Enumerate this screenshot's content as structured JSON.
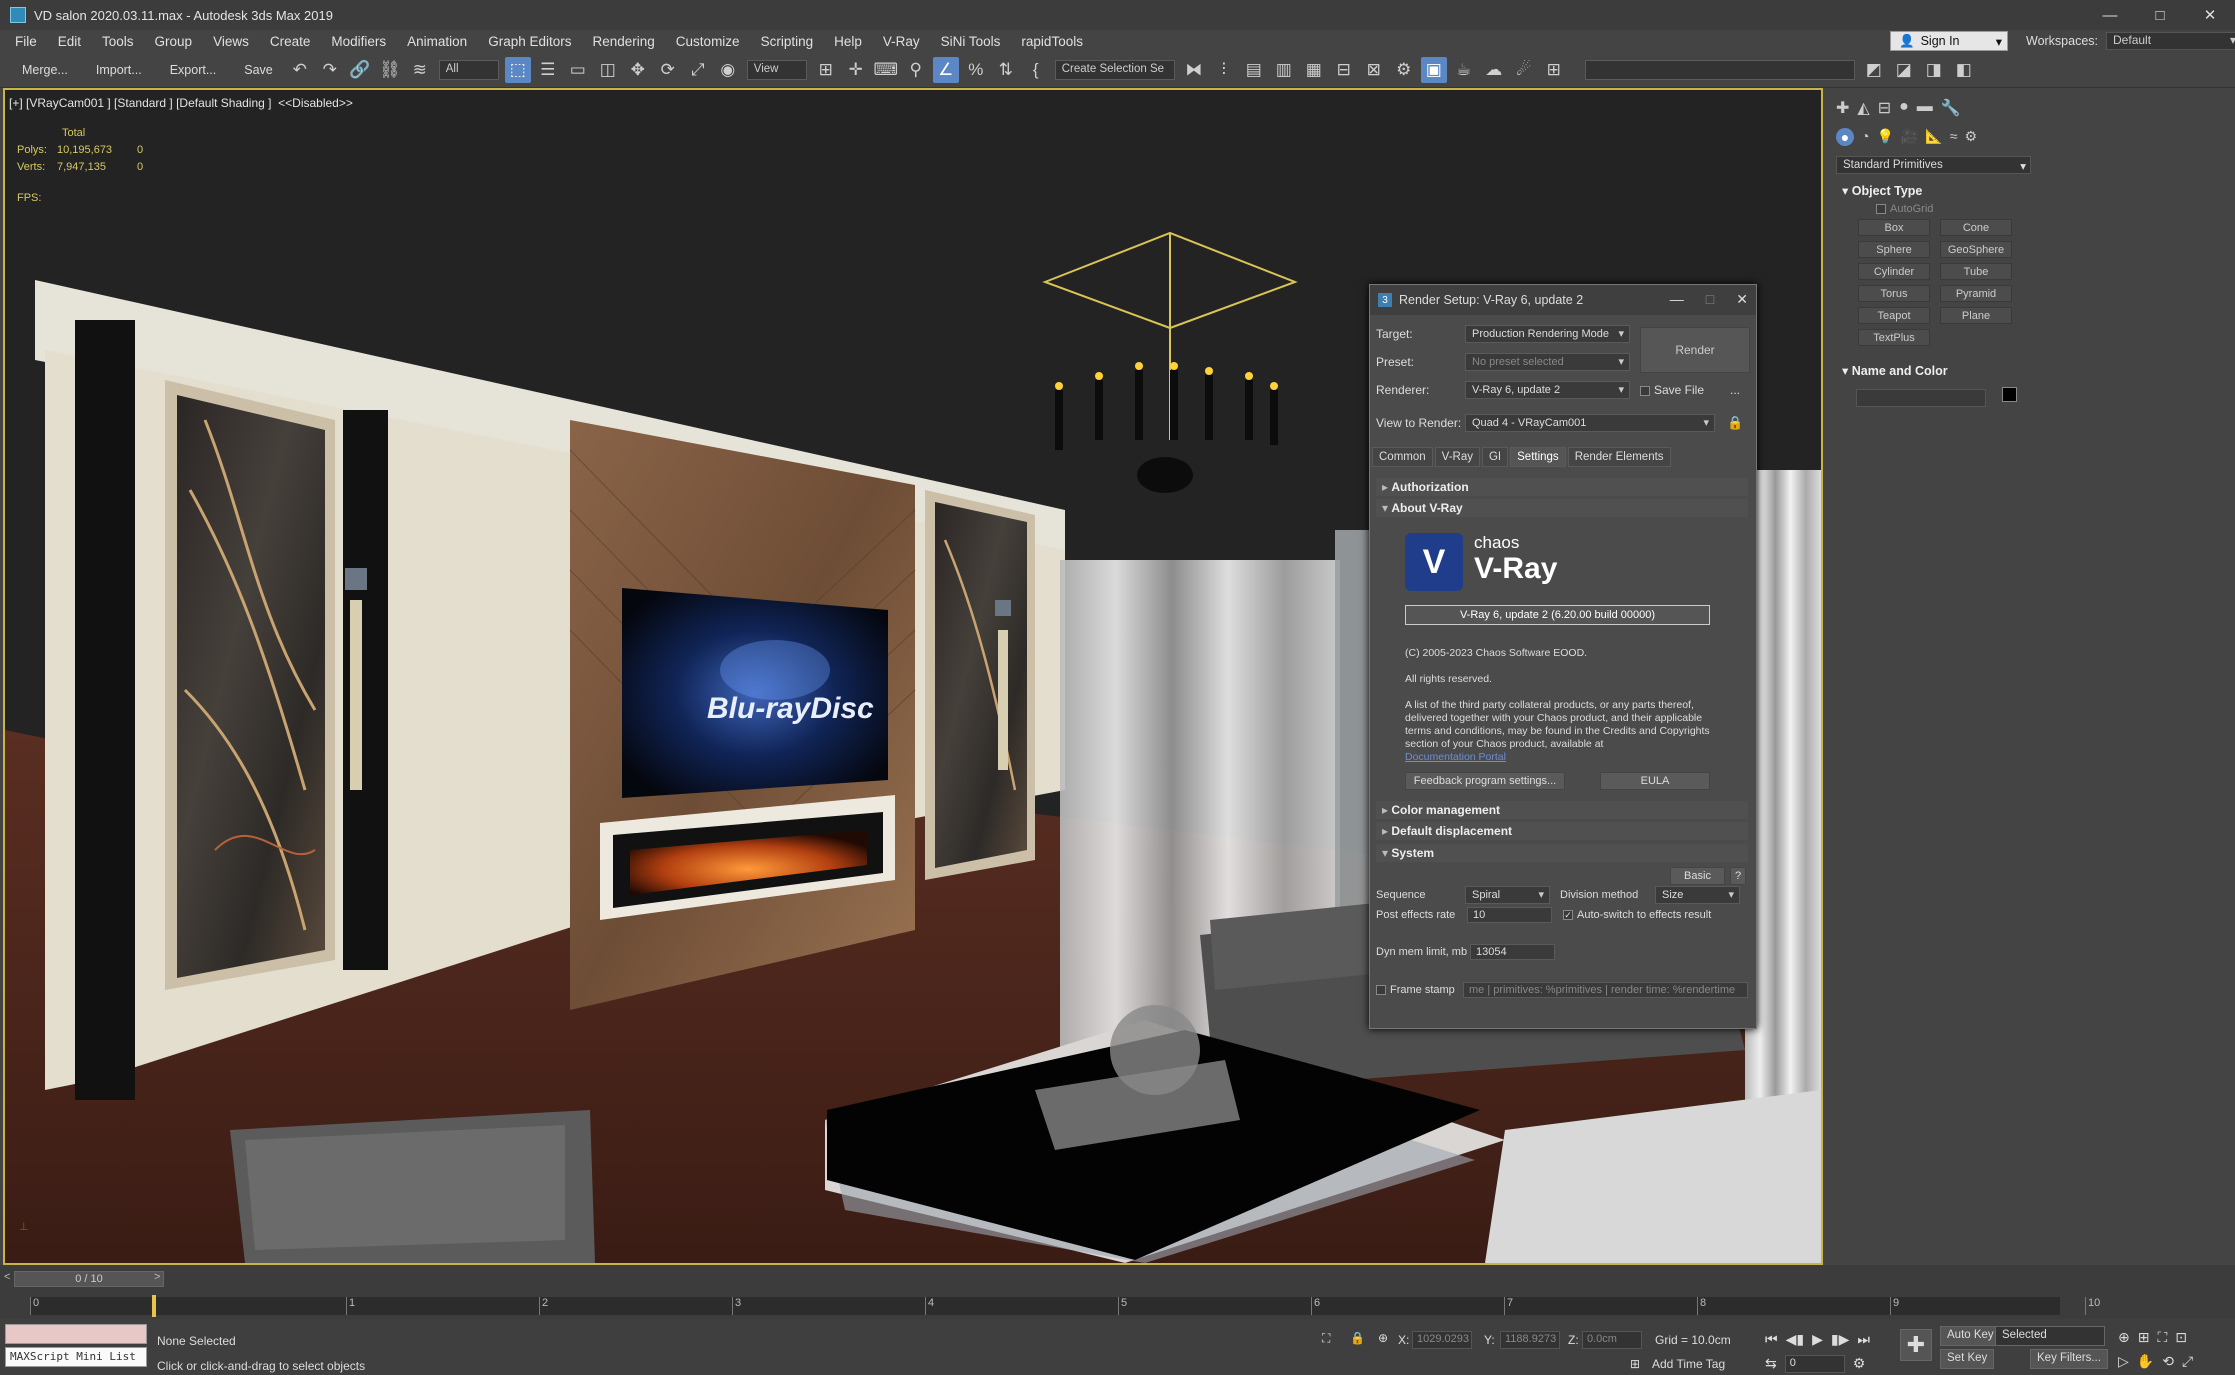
{
  "window": {
    "title": "VD salon 2020.03.11.max - Autodesk 3ds Max 2019",
    "min": "—",
    "max": "□",
    "close": "✕"
  },
  "menu": [
    "File",
    "Edit",
    "Tools",
    "Group",
    "Views",
    "Create",
    "Modifiers",
    "Animation",
    "Graph Editors",
    "Rendering",
    "Customize",
    "Scripting",
    "Help",
    "V-Ray",
    "SiNi Tools",
    "rapidTools"
  ],
  "account": {
    "sign_in": "Sign In",
    "workspaces_label": "Workspaces:",
    "workspace": "Default"
  },
  "toolbar": {
    "merge": "Merge...",
    "import": "Import...",
    "export": "Export...",
    "save": "Save",
    "filter": "All",
    "refcoord": "View",
    "selection_set": "Create Selection Se"
  },
  "viewport": {
    "label": "[+] [VRayCam001 ] [Standard ] [Default Shading ]  <<Disabled>>",
    "stats": {
      "total": "Total",
      "polys_label": "Polys:",
      "polys": "10,195,673",
      "polys_sel": "0",
      "verts_label": "Verts:",
      "verts": "7,947,135",
      "verts_sel": "0",
      "fps": "FPS:"
    }
  },
  "command_panel": {
    "category": "Standard Primitives",
    "object_type_title": "Object Type",
    "autogrid": "AutoGrid",
    "objects": [
      "Box",
      "Cone",
      "Sphere",
      "GeoSphere",
      "Cylinder",
      "Tube",
      "Torus",
      "Pyramid",
      "Teapot",
      "Plane",
      "TextPlus"
    ],
    "name_color_title": "Name and Color"
  },
  "render_setup": {
    "title": "Render Setup: V-Ray 6, update 2",
    "target_label": "Target:",
    "target": "Production Rendering Mode",
    "preset_label": "Preset:",
    "preset": "No preset selected",
    "renderer_label": "Renderer:",
    "renderer": "V-Ray 6, update 2",
    "save_file": "Save File",
    "dots": "...",
    "view_label": "View to Render:",
    "view": "Quad 4 - VRayCam001",
    "render_btn": "Render",
    "tabs": [
      "Common",
      "V-Ray",
      "GI",
      "Settings",
      "Render Elements"
    ],
    "authorization": "Authorization",
    "about": "About V-Ray",
    "brand_small": "chaos",
    "brand_big": "V-Ray",
    "version": "V-Ray 6, update 2 (6.20.00 build 00000)",
    "copyright": "(C) 2005-2023 Chaos Software EOOD.",
    "rights": "All rights reserved.",
    "notice": "A list of the third party collateral products, or any parts thereof, delivered together with your Chaos product, and their applicable terms and conditions, may be found in the Credits and Copyrights section of your Chaos product, available at",
    "doc_link": "Documentation Portal",
    "feedback_btn": "Feedback program settings...",
    "eula_btn": "EULA",
    "color_mgmt": "Color management",
    "default_disp": "Default displacement",
    "system": "System",
    "basic_btn": "Basic",
    "help_btn": "?",
    "sequence_label": "Sequence",
    "sequence": "Spiral",
    "division_label": "Division method",
    "division": "Size",
    "post_label": "Post effects rate",
    "post": "10",
    "autoswitch": "Auto-switch to effects result",
    "dyn_label": "Dyn mem limit, mb",
    "dyn": "13054",
    "frame_stamp": "Frame stamp",
    "frame_stamp_text": "me | primitives: %primitives | render time: %rendertime"
  },
  "timeline": {
    "slider": "0 / 10",
    "ticks": [
      "0",
      "1",
      "2",
      "3",
      "4",
      "5",
      "6",
      "7",
      "8",
      "9",
      "10"
    ],
    "prev": "<",
    "next": ">"
  },
  "status": {
    "maxscript": "MAXScript Mini List",
    "selection": "None Selected",
    "prompt": "Click or click-and-drag to select objects",
    "x_label": "X:",
    "x": "1029.0293",
    "y_label": "Y:",
    "y": "1188.9273",
    "z_label": "Z:",
    "z": "0.0cm",
    "grid": "Grid = 10.0cm",
    "add_time_tag": "Add Time Tag",
    "auto_key": "Auto Key",
    "selected": "Selected",
    "set_key": "Set Key",
    "key_filters": "Key Filters...",
    "frame": "0"
  },
  "colors": {
    "accent": "#5b88c4",
    "viewport_border": "#c8b447",
    "stats_text": "#d8c860"
  }
}
